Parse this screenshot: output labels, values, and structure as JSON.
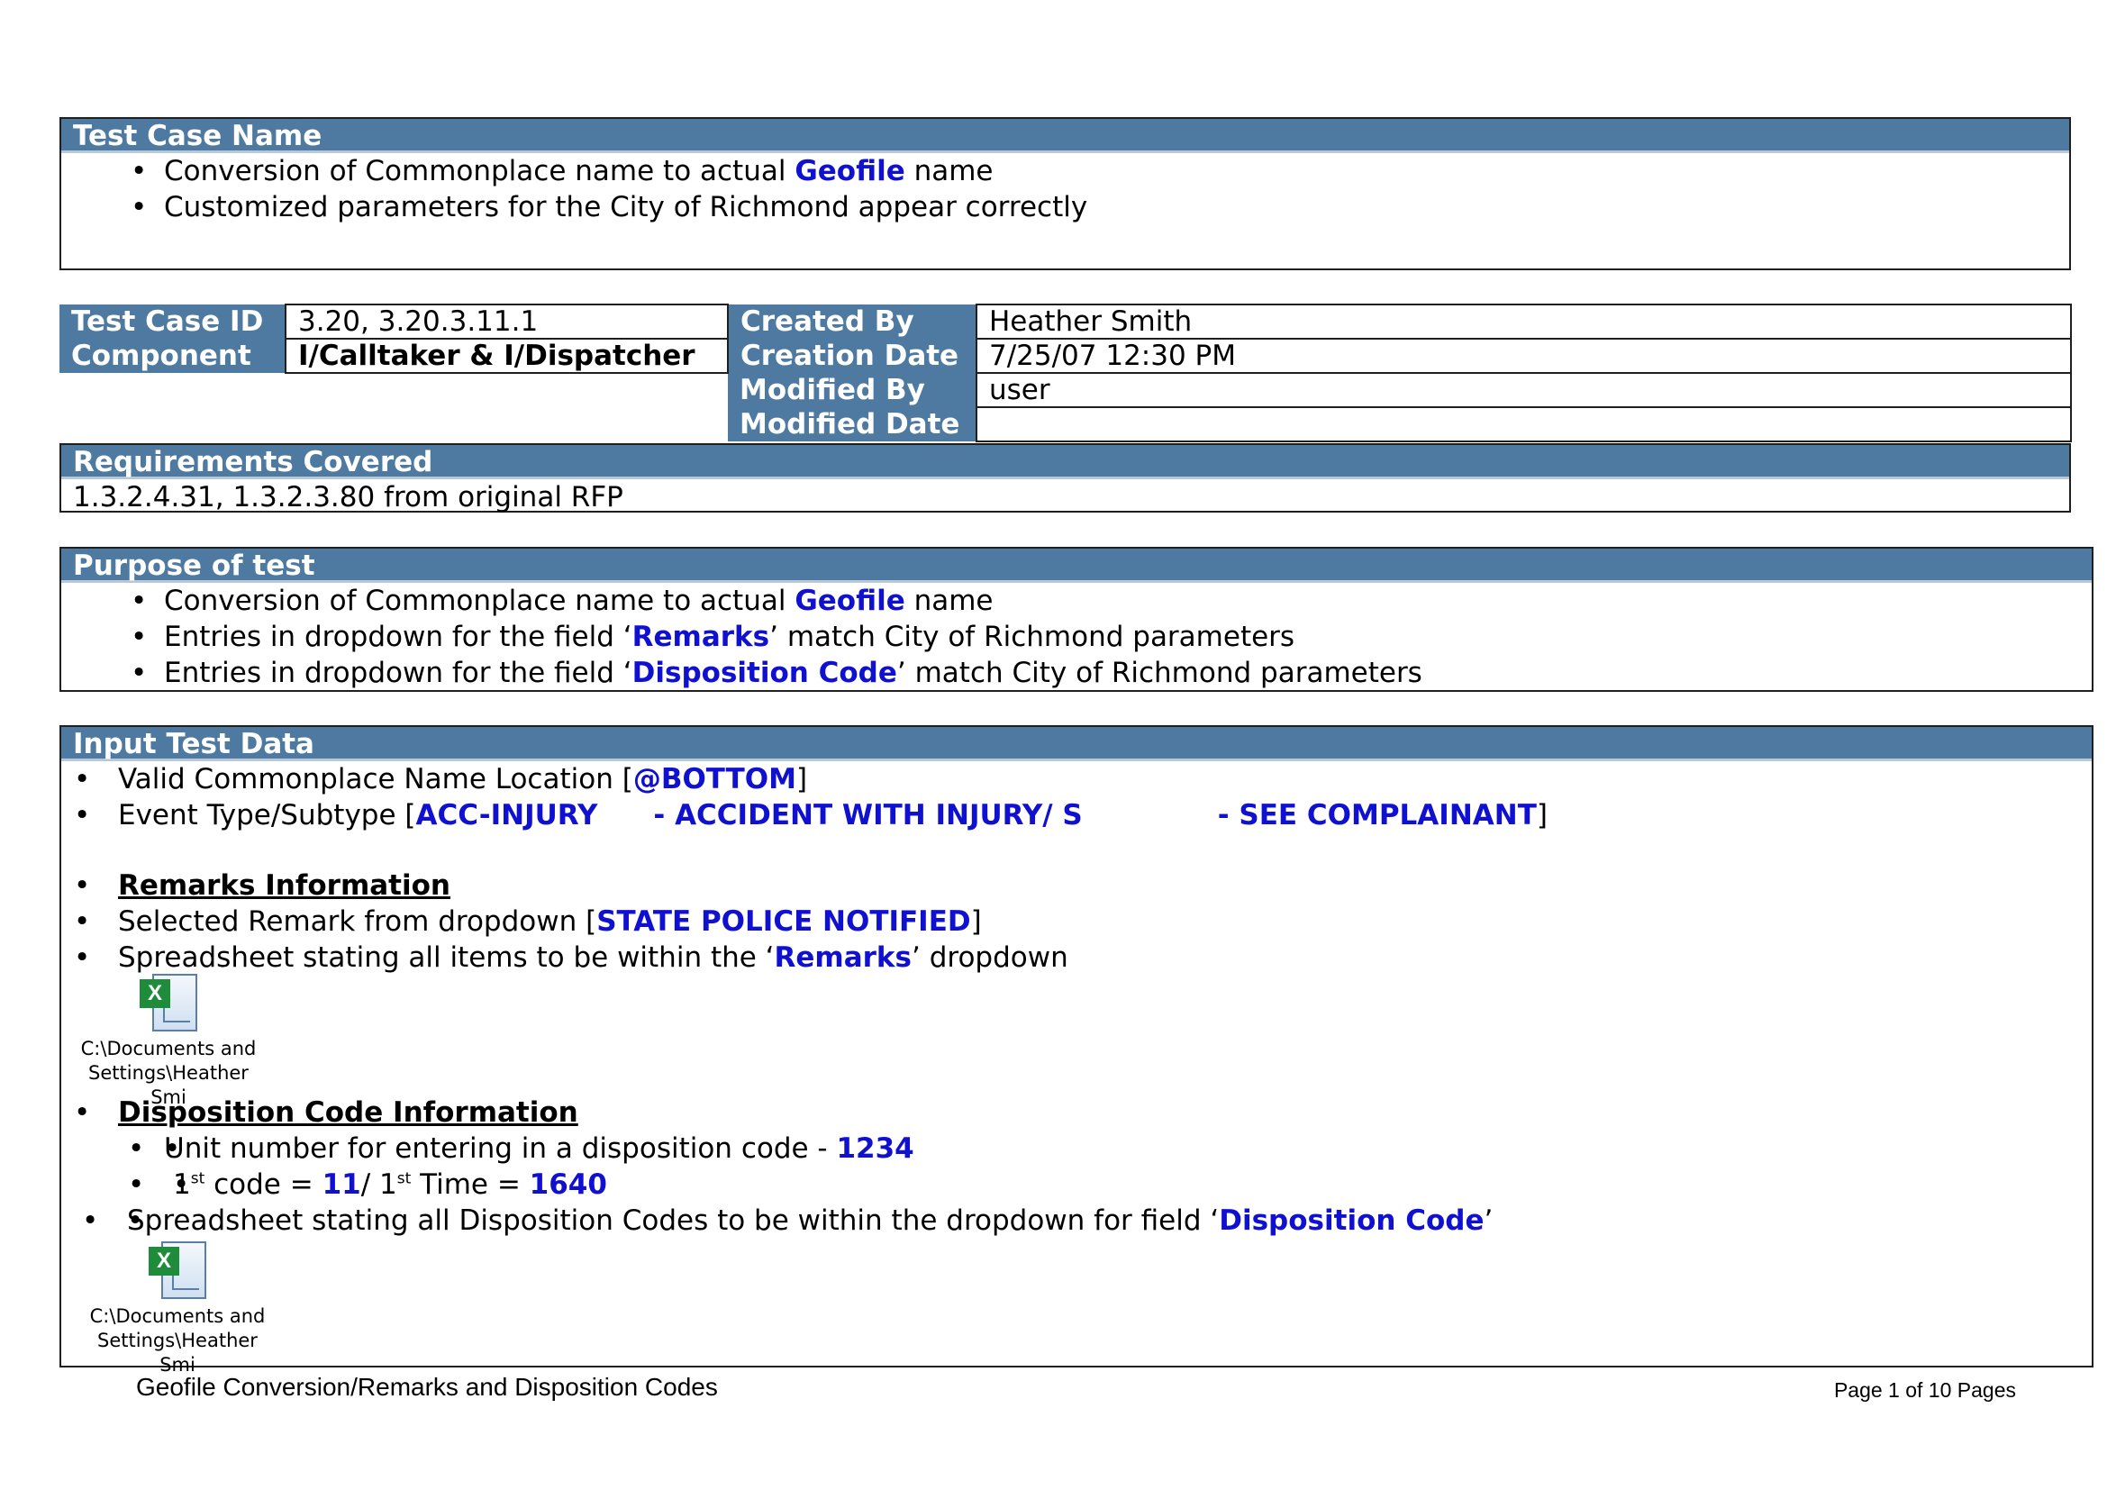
{
  "test_case_name": {
    "header": "Test Case Name",
    "items": [
      {
        "pre": "Conversion of Commonplace name to actual ",
        "hl": "Geofile",
        "post": " name"
      },
      {
        "pre": "Customized parameters for the City of Richmond appear correctly",
        "hl": "",
        "post": ""
      }
    ]
  },
  "info": {
    "test_case_id_label": "Test Case ID",
    "test_case_id_value": "3.20, 3.20.3.11.1",
    "component_label": "Component",
    "component_value": "I/Calltaker & I/Dispatcher",
    "created_by_label": "Created By",
    "created_by_value": "Heather Smith",
    "creation_date_label": "Creation Date",
    "creation_date_value": "7/25/07 12:30 PM",
    "modified_by_label": "Modified By",
    "modified_by_value": "user",
    "modified_date_label": "Modified Date",
    "modified_date_value": ""
  },
  "requirements": {
    "header": "Requirements Covered",
    "text": "1.3.2.4.31, 1.3.2.3.80 from original RFP"
  },
  "purpose": {
    "header": "Purpose of test",
    "items": [
      {
        "pre": "Conversion of Commonplace name to actual ",
        "hl": "Geofile",
        "post": " name"
      },
      {
        "pre": "Entries in dropdown for the field ‘",
        "hl": "Remarks",
        "post": "’ match City of Richmond parameters"
      },
      {
        "pre": "Entries in dropdown for the field ‘",
        "hl": "Disposition Code",
        "post": "’ match City of Richmond parameters"
      }
    ]
  },
  "input": {
    "header": "Input Test Data",
    "location_pre": "Valid Commonplace Name Location [",
    "location_hl": "@BOTTOM",
    "location_post": "]",
    "event_pre": "Event Type/Subtype [",
    "event_type": "ACC-INJURY",
    "event_desc": "- ACCIDENT WITH INJURY/ S",
    "event_sub": "- SEE COMPLAINANT",
    "event_post": "]",
    "remarks_heading": "Remarks Information",
    "remark_sel_pre": "Selected Remark from dropdown [",
    "remark_sel_hl": "STATE POLICE NOTIFIED",
    "remark_sel_post": "]",
    "remark_sheet_pre": "Spreadsheet stating all items to be within the ‘",
    "remark_sheet_hl": "Remarks",
    "remark_sheet_post": "’ dropdown",
    "attachment1_line1": "C:\\Documents and",
    "attachment1_line2": "Settings\\Heather Smi",
    "disp_heading": "Disposition Code Information",
    "unit_pre": "Unit number for entering in a disposition code - ",
    "unit_hl": "1234",
    "code_num1": "1",
    "code_sup1": "st",
    "code_text1": " code = ",
    "code_val": "11",
    "code_sep": "/ 1",
    "code_sup2": "st",
    "code_text2": " Time = ",
    "time_val": "1640",
    "disp_sheet_pre": "Spreadsheet stating all Disposition Codes to be within the dropdown for field ‘",
    "disp_sheet_hl": "Disposition Code",
    "disp_sheet_post": "’",
    "attachment2_line1": "C:\\Documents and",
    "attachment2_line2": "Settings\\Heather Smi"
  },
  "footer": {
    "title": "Geofile Conversion/Remarks and Disposition Codes",
    "page": "Page 1 of 10 Pages"
  },
  "colors": {
    "header_bg": "#4e79a0",
    "highlight": "#1010d0"
  }
}
